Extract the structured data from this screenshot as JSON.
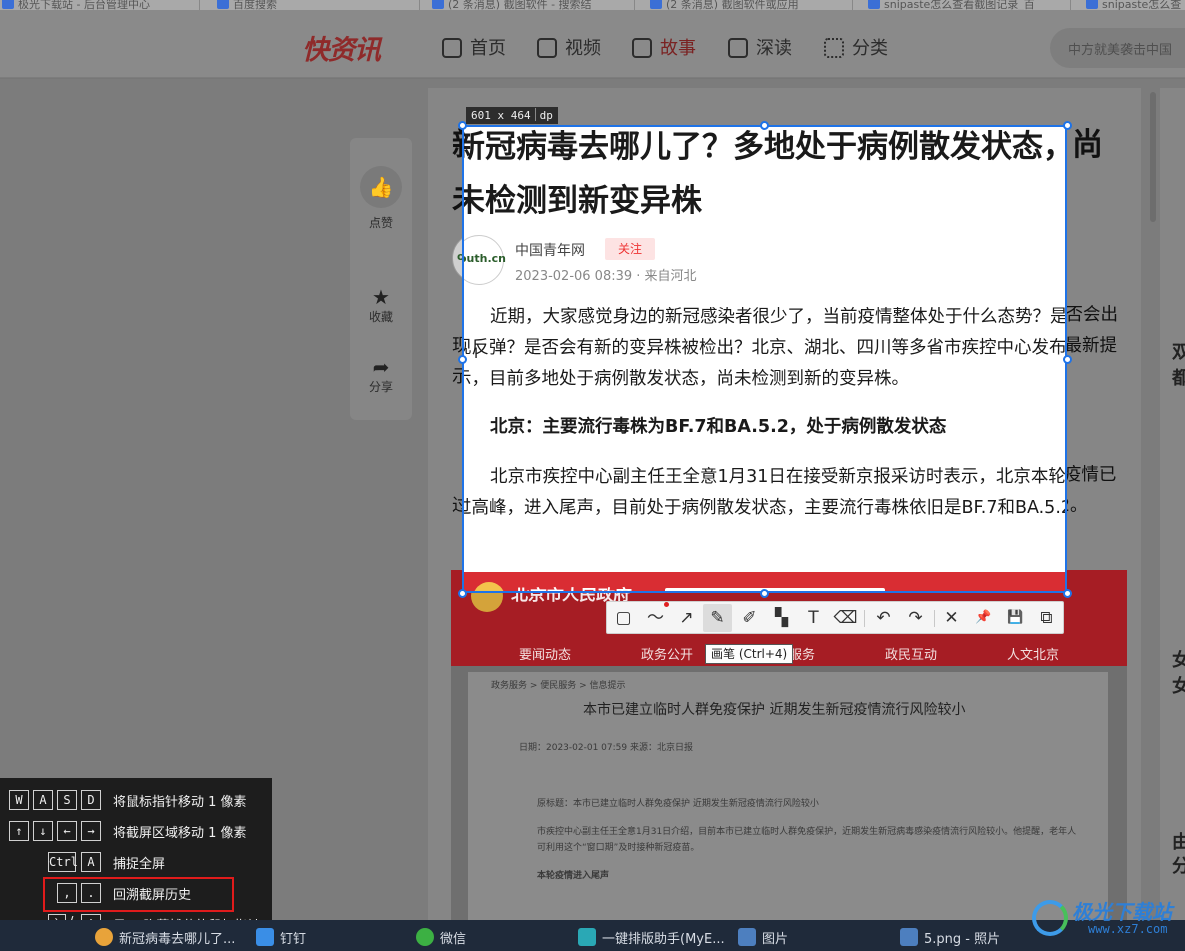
{
  "browser_tabs": [
    {
      "label": "极光下载站 - 后台管理中心"
    },
    {
      "label": "百度搜索"
    },
    {
      "label": "(2 条消息) 截图软件 - 搜索结"
    },
    {
      "label": "(2 条消息) 截图软件或应用"
    },
    {
      "label": "snipaste怎么查看截图记录_百"
    },
    {
      "label": "snipaste怎么查"
    }
  ],
  "site": {
    "logo": "快资讯",
    "nav": [
      {
        "label": "首页",
        "icon": "home-icon"
      },
      {
        "label": "视频",
        "icon": "video-icon"
      },
      {
        "label": "故事",
        "icon": "story-icon"
      },
      {
        "label": "深读",
        "icon": "deep-read-icon"
      },
      {
        "label": "分类",
        "icon": "category-icon"
      }
    ],
    "search_placeholder": "中方就美袭击中国"
  },
  "side_actions": [
    {
      "label": "点赞",
      "icon": "thumbs-up-icon"
    },
    {
      "label": "收藏",
      "icon": "star-icon"
    },
    {
      "label": "分享",
      "icon": "share-icon"
    }
  ],
  "article": {
    "title": "新冠病毒去哪儿了？多地处于病例散发状态，尚未检测到新变异株",
    "author": "中国青年网",
    "avatar_text": "outh.cn",
    "follow": "关注",
    "meta": "2023-02-06 08:39 · 来自河北",
    "paragraphs": [
      "近期，大家感觉身边的新冠感染者很少了，当前疫情整体处于什么态势？是否会出现反弹？是否会有新的变异株被检出？北京、湖北、四川等多省市疾控中心发布最新提示，目前多地处于病例散发状态，尚未检测到新的变异株。",
      "北京：主要流行毒株为BF.7和BA.5.2，处于病例散发状态",
      "北京市疾控中心副主任王全意1月31日在接受新京报采访时表示，北京本轮疫情已过高峰，进入尾声，目前处于病例散发状态，主要流行毒株依旧是BF.7和BA.5.2。"
    ],
    "embed": {
      "site_name": "北京市人民政府",
      "nav": [
        "要闻动态",
        "政务公开",
        "办事服务",
        "政民互动",
        "人文北京"
      ],
      "headline": "本市已建立临时人群免疫保护 近期发生新冠疫情流行风险较小",
      "breadcrumb": "政务服务 > 便民服务 > 信息提示",
      "date_line": "日期：2023-02-01 07:59    来源：北京日报",
      "source_line": "原标题：本市已建立临时人群免疫保护 近期发生新冠疫情流行风险较小",
      "body_line1": "市疾控中心副主任王全意1月31日介绍，目前本市已建立临时人群免疫保护，近期发生新冠病毒感染疫情流行风险较小。他提醒，老年人",
      "body_line2": "可利用这个“窗口期”及时接种新冠疫苗。",
      "section": "本轮疫情进入尾声"
    }
  },
  "capture": {
    "size_label": "601 x 464",
    "unit_label": "dp",
    "tooltip": "画笔 (Ctrl+4)",
    "tools": [
      {
        "name": "rectangle-tool",
        "glyph": "▢"
      },
      {
        "name": "curve-tool",
        "glyph": "〜"
      },
      {
        "name": "arrow-tool",
        "glyph": "↗"
      },
      {
        "name": "pencil-tool",
        "glyph": "✎"
      },
      {
        "name": "highlighter-tool",
        "glyph": "✐"
      },
      {
        "name": "mosaic-tool",
        "glyph": "▚"
      },
      {
        "name": "text-tool",
        "glyph": "T"
      },
      {
        "name": "eraser-tool",
        "glyph": "⌫"
      },
      {
        "name": "undo-tool",
        "glyph": "↶"
      },
      {
        "name": "redo-tool",
        "glyph": "↷"
      },
      {
        "name": "close-tool",
        "glyph": "✕"
      },
      {
        "name": "pin-tool",
        "glyph": "📌"
      },
      {
        "name": "save-tool",
        "glyph": "💾"
      },
      {
        "name": "copy-tool",
        "glyph": "⧉"
      }
    ]
  },
  "hints": [
    {
      "keys": [
        "W",
        "A",
        "S",
        "D"
      ],
      "desc": "将鼠标指针移动 1 像素"
    },
    {
      "keys": [
        "↑",
        "↓",
        "←",
        "→"
      ],
      "desc": "将截屏区域移动 1 像素"
    },
    {
      "keys": [
        "Ctrl",
        "A"
      ],
      "desc": "捕捉全屏"
    },
    {
      "keys": [
        ",",
        "."
      ],
      "desc": "回溯截屏历史"
    },
    {
      "keys": [
        "`",
        "!"
      ],
      "desc": "显示/隐藏捕获的鼠标指针",
      "separator": "/"
    }
  ],
  "taskbar": [
    {
      "label": "新冠病毒去哪儿了...",
      "color": "#e8a33a"
    },
    {
      "label": "钉钉",
      "color": "#3a8ee6"
    },
    {
      "label": "微信",
      "color": "#3cb043"
    },
    {
      "label": "一键排版助手(MyE...",
      "color": "#2aa8b5"
    },
    {
      "label": "图片",
      "color": "#4d7fbf"
    },
    {
      "label": "5.png - 照片",
      "color": "#4d7fbf"
    }
  ],
  "watermark": {
    "text": "极光下载站",
    "sub": "www.xz7.com"
  },
  "side_peek": [
    "双",
    "都",
    "女",
    "女",
    "由",
    "分"
  ],
  "colors": {
    "selection": "#1e73e8",
    "highlight_box": "#e11b1b",
    "brand_red": "#d92d33"
  }
}
